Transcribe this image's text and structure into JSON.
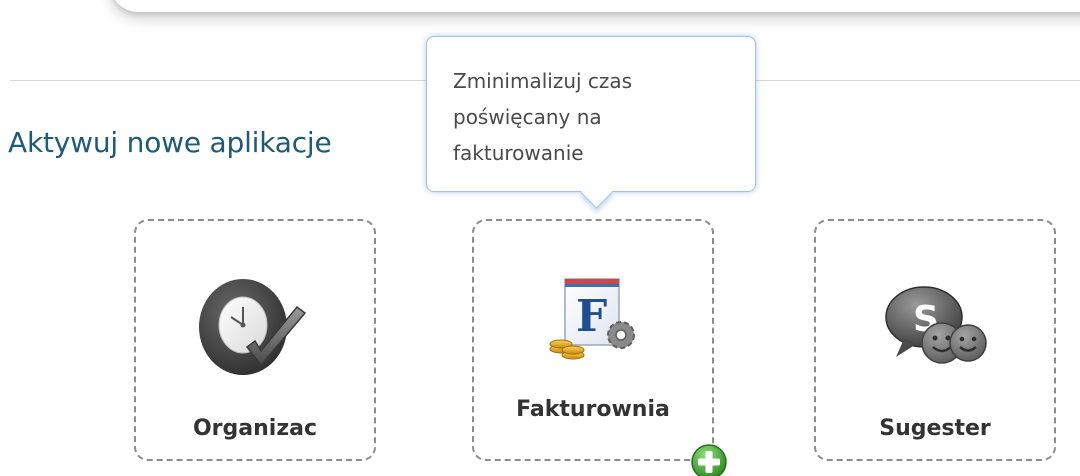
{
  "section": {
    "title": "Aktywuj nowe aplikacje"
  },
  "tooltip": {
    "lines": [
      "Zminimalizuj czas",
      "poświęcany na",
      "fakturowanie"
    ]
  },
  "apps": [
    {
      "name": "Organizac",
      "icon": "clock-check-icon"
    },
    {
      "name": "Fakturownia",
      "icon": "invoice-gear-icon",
      "badge": "add-plus-icon"
    },
    {
      "name": "Sugester",
      "icon": "speech-smiley-icon"
    }
  ],
  "colors": {
    "title": "#1f5b74",
    "tooltip_border": "#9ec3ec",
    "tile_border": "#8c8c8c",
    "badge_green": "#4caf3a"
  }
}
